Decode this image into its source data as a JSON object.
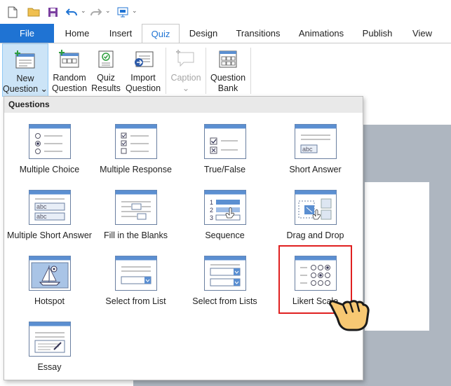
{
  "quick_access": {
    "icons": [
      "new-document-icon",
      "open-folder-icon",
      "save-icon",
      "undo-icon",
      "redo-icon",
      "preview-icon"
    ]
  },
  "tabs": [
    {
      "label": "File"
    },
    {
      "label": "Home"
    },
    {
      "label": "Insert"
    },
    {
      "label": "Quiz"
    },
    {
      "label": "Design"
    },
    {
      "label": "Transitions"
    },
    {
      "label": "Animations"
    },
    {
      "label": "Publish"
    },
    {
      "label": "View"
    }
  ],
  "active_tab": "Quiz",
  "ribbon": {
    "new_question": {
      "line1": "New",
      "line2": "Question ⌄"
    },
    "random_question": {
      "line1": "Random",
      "line2": "Question"
    },
    "quiz_results": {
      "line1": "Quiz",
      "line2": "Results"
    },
    "import_question": {
      "line1": "Import",
      "line2": "Question"
    },
    "caption": {
      "line1": "Caption",
      "line2": "⌄"
    },
    "question_bank": {
      "line1": "Question",
      "line2": "Bank"
    }
  },
  "dropdown": {
    "header": "Questions",
    "items": [
      {
        "label": "Multiple Choice",
        "icon": "multiple-choice-icon"
      },
      {
        "label": "Multiple Response",
        "icon": "multiple-response-icon"
      },
      {
        "label": "True/False",
        "icon": "true-false-icon"
      },
      {
        "label": "Short Answer",
        "icon": "short-answer-icon"
      },
      {
        "label": "Multiple Short Answer",
        "icon": "multiple-short-answer-icon"
      },
      {
        "label": "Fill in the Blanks",
        "icon": "fill-in-blanks-icon"
      },
      {
        "label": "Sequence",
        "icon": "sequence-icon"
      },
      {
        "label": "Drag and Drop",
        "icon": "drag-and-drop-icon"
      },
      {
        "label": "Hotspot",
        "icon": "hotspot-icon"
      },
      {
        "label": "Select from List",
        "icon": "select-from-list-icon"
      },
      {
        "label": "Select from Lists",
        "icon": "select-from-lists-icon"
      },
      {
        "label": "Likert Scale",
        "icon": "likert-scale-icon"
      },
      {
        "label": "Essay",
        "icon": "essay-icon"
      }
    ],
    "abc_text": "abc",
    "sequence_numbers": [
      "1",
      "2",
      "3"
    ]
  },
  "colors": {
    "accent": "#1f73d3",
    "thumb_header": "#5b8fd1",
    "highlight": "#e02020",
    "hand": "#f7c873"
  }
}
